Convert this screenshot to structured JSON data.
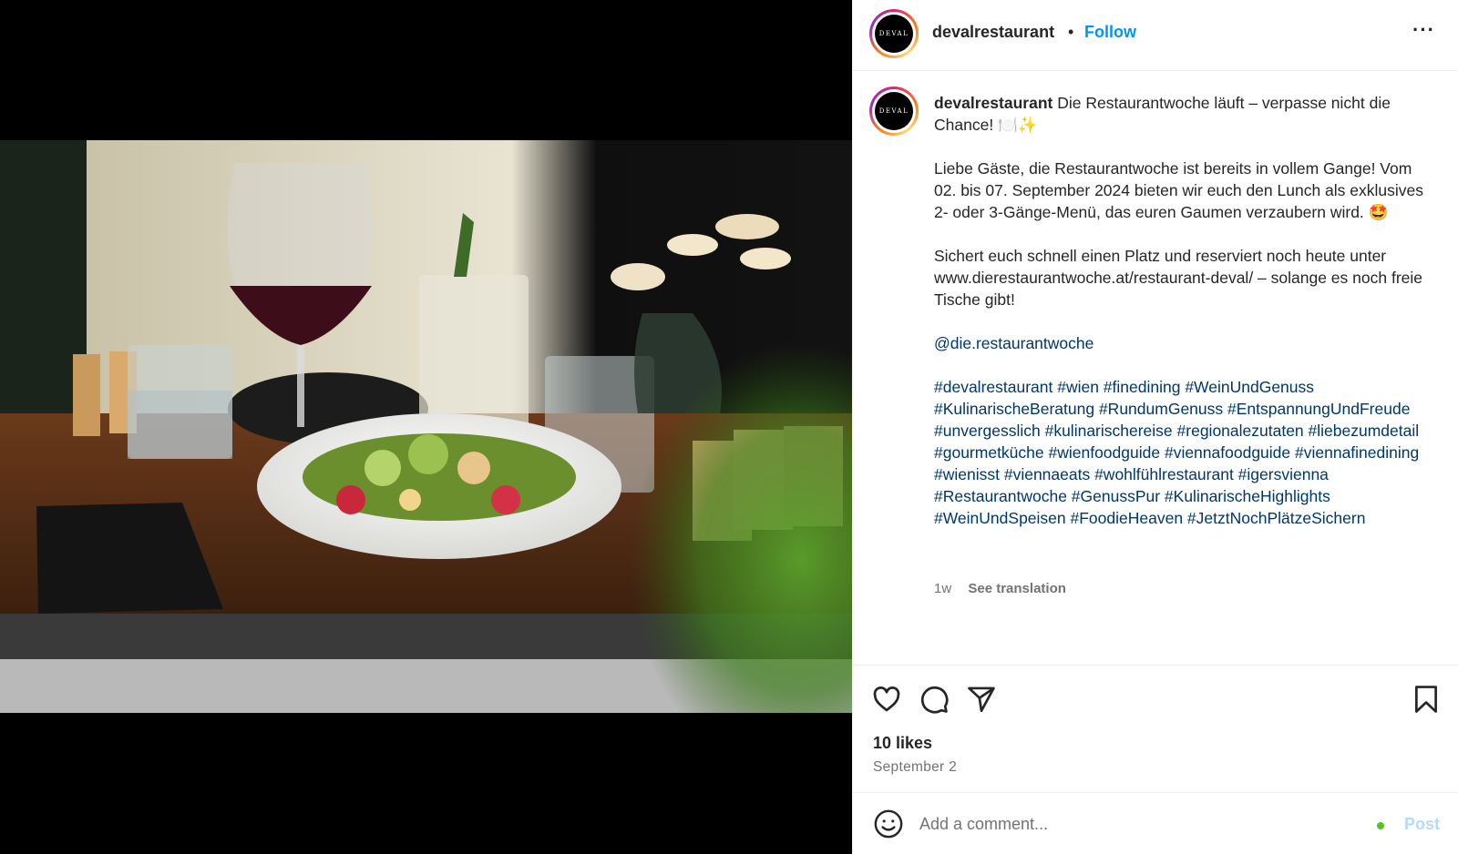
{
  "post": {
    "username": "devalrestaurant",
    "avatar_text": "DEVAL",
    "separator": "•",
    "follow_label": "Follow",
    "more_label": "···",
    "caption": {
      "title": "Die Restaurantwoche läuft – verpasse nicht die Chance! 🍽️✨",
      "paragraph1": "Liebe Gäste, die Restaurantwoche ist bereits in vollem Gange! Vom 02. bis 07. September 2024 bieten wir euch den Lunch als exklusives 2- oder 3-Gänge-Menü, das euren Gaumen verzaubern wird. 🤩",
      "paragraph2": "Sichert euch schnell einen Platz und reserviert noch heute unter www.dierestaurantwoche.at/restaurant-deval/ – solange es noch freie Tische gibt!",
      "mention": "@die.restaurantwoche",
      "hashtags": "#devalrestaurant #wien #finedining #WeinUndGenuss #KulinarischeBeratung #RundumGenuss #EntspannungUndFreude #unvergesslich #kulinarischereise #regionalezutaten #liebezumdetail #gourmetküche #wienfoodguide #viennafoodguide #viennafinedining #wienisst #viennaeats #wohlfühlrestaurant #igersvienna #Restaurantwoche #GenussPur #KulinarischeHighlights #WeinUndSpeisen #FoodieHeaven #JetztNochPlätzeSichern"
    },
    "time_ago": "1w",
    "see_translation": "See translation",
    "likes": "10 likes",
    "date": "September 2"
  },
  "actions": {
    "like_icon": "heart-icon",
    "comment_icon": "comment-icon",
    "share_icon": "paper-plane-icon",
    "save_icon": "bookmark-icon"
  },
  "comment": {
    "placeholder": "Add a comment...",
    "post_label": "Post",
    "emoji_icon": "smiley-icon"
  },
  "colors": {
    "accent": "#0095f6",
    "link": "#00376b",
    "muted": "#737373",
    "post_disabled": "#b3dbff"
  }
}
